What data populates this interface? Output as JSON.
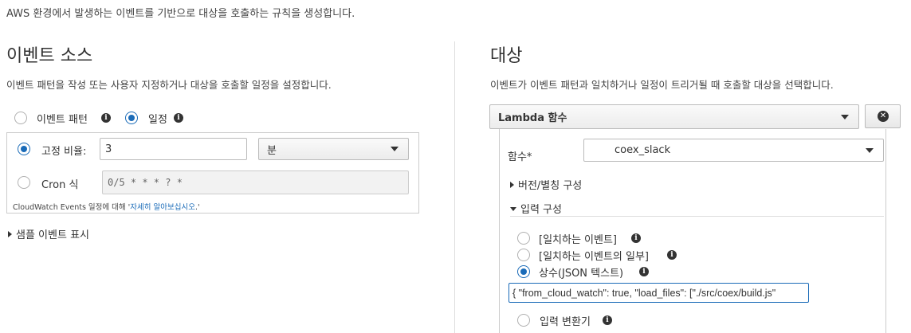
{
  "top_description": "AWS 환경에서 발생하는 이벤트를 기반으로 대상을 호출하는 규칙을 생성합니다.",
  "source": {
    "title": "이벤트 소스",
    "description": "이벤트 패턴을 작성 또는 사용자 지정하거나 대상을 호출할 일정을 설정합니다.",
    "radio_event_pattern": "이벤트 패턴",
    "radio_schedule": "일정",
    "fixed_rate_label": "고정 비율:",
    "fixed_rate_value": "3",
    "unit_select": "분",
    "cron_label": "Cron 식",
    "cron_placeholder": "0/5 * * * ? *",
    "cloudwatch_note_prefix": "CloudWatch Events 일정에 대해 '",
    "cloudwatch_note_link": "자세히 알아보십시오",
    "cloudwatch_note_suffix": ".'",
    "sample_events": "샘플 이벤트 표시"
  },
  "target": {
    "title": "대상",
    "description": "이벤트가 이벤트 패턴과 일치하거나 일정이 트리거될 때 호출할 대상을 선택합니다.",
    "type_select": "Lambda 함수",
    "function_label": "함수*",
    "function_select": "coex_slack",
    "version_alias": "버전/별칭 구성",
    "input_config": "입력 구성",
    "radio_matched_event": "[일치하는 이벤트]",
    "radio_matched_part": "[일치하는 이벤트의 일부]",
    "radio_constant": "상수(JSON 텍스트)",
    "json_value": "{ \"from_cloud_watch\": true, \"load_files\": [\"./src/coex/build.js\"",
    "radio_input_transformer": "입력 변환기"
  },
  "icons": {
    "info": "info-icon",
    "remove": "remove-icon",
    "caret": "caret-down-icon"
  },
  "colors": {
    "accent": "#1a6bb8"
  }
}
